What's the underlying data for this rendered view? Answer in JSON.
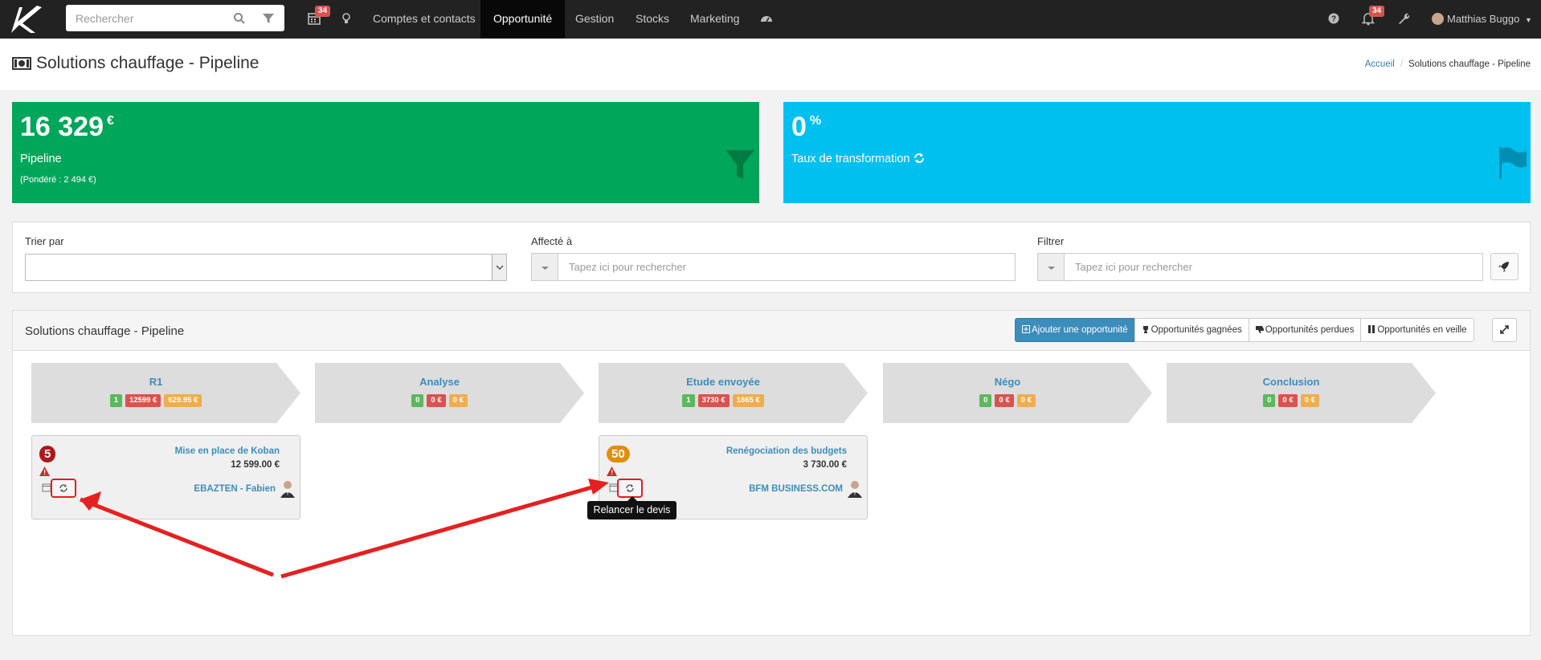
{
  "navbar": {
    "logo": "K",
    "search_placeholder": "Rechercher",
    "calendar_badge": "34",
    "notifications_badge": "34",
    "links": [
      "Comptes et contacts",
      "Opportunité",
      "Gestion",
      "Stocks",
      "Marketing"
    ],
    "active_link": "Opportunité",
    "user_name": "Matthias Buggo"
  },
  "header": {
    "title": "Solutions chauffage - Pipeline",
    "breadcrumb": [
      "Accueil",
      "Solutions chauffage - Pipeline"
    ]
  },
  "stats": {
    "pipeline": {
      "value": "16 329",
      "unit": "€",
      "label": "Pipeline",
      "sub": "(Pondéré : 2 494 €)",
      "color": "#00a65a"
    },
    "transformation": {
      "value": "0",
      "unit": "%",
      "label": "Taux de transformation",
      "color": "#00c0ef"
    }
  },
  "filters": {
    "sort_label": "Trier par",
    "assigned_label": "Affecté à",
    "assigned_placeholder": "Tapez ici pour rechercher",
    "filter_label": "Filtrer",
    "filter_placeholder": "Tapez ici pour rechercher"
  },
  "pipeline": {
    "title": "Solutions chauffage - Pipeline",
    "buttons": {
      "add": "Ajouter une opportunité",
      "won": "Opportunités gagnées",
      "lost": "Opportunités perdues",
      "standby": "Opportunités en veille"
    },
    "stages": [
      {
        "name": "R1",
        "count": "1",
        "amount": "12599 €",
        "weighted": "629.95 €"
      },
      {
        "name": "Analyse",
        "count": "0",
        "amount": "0 €",
        "weighted": "0 €"
      },
      {
        "name": "Etude envoyée",
        "count": "1",
        "amount": "3730 €",
        "weighted": "1865 €"
      },
      {
        "name": "Négo",
        "count": "0",
        "amount": "0 €",
        "weighted": "0 €"
      },
      {
        "name": "Conclusion",
        "count": "0",
        "amount": "0 €",
        "weighted": "0 €"
      }
    ],
    "cards": [
      {
        "score": "5",
        "score_color": "#b0171d",
        "title": "Mise en place de Koban",
        "amount": "12 599.00 €",
        "company": "EBAZTEN - Fabien"
      },
      {
        "score": "50",
        "score_color": "#e08e0b",
        "title": "Renégociation des budgets",
        "amount": "3 730.00 €",
        "company": "BFM BUSINESS.COM"
      }
    ],
    "tooltip": "Relancer le devis"
  }
}
